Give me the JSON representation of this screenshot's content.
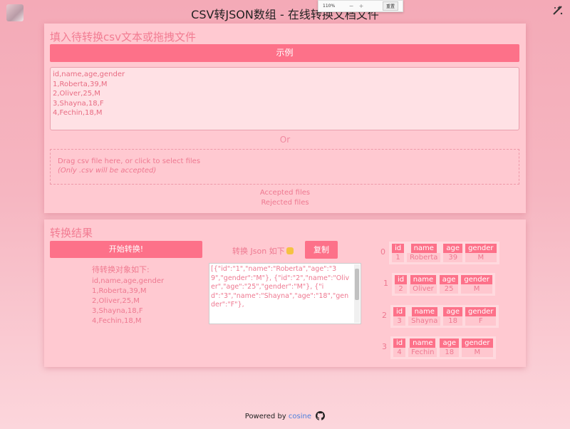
{
  "header": {
    "title": "CSV转JSON数组 - 在线转换文档文件"
  },
  "zoom_popup": {
    "value": "110%",
    "minus": "−",
    "plus": "+",
    "reset": "重置"
  },
  "input_card": {
    "title": "填入待转换csv文本或拖拽文件",
    "example_label": "示例",
    "csv_text": "id,name,age,gender\n1,Roberta,39,M\n2,Oliver,25,M\n3,Shayna,18,F\n4,Fechin,18,M",
    "or_label": "Or",
    "drop_hint": "Drag csv file here, or click to select files",
    "drop_note": "(Only .csv will be accepted)",
    "accepted_label": "Accepted files",
    "rejected_label": "Rejected files"
  },
  "result_card": {
    "title": "转换结果",
    "start_label": "开始转换!",
    "pending_title": "待转换对象如下:",
    "pending_lines": "id,name,age,gender\n1,Roberta,39,M\n2,Oliver,25,M\n3,Shayna,18,F\n4,Fechin,18,M",
    "json_label": "转换 Json 如下",
    "copy_label": "复制",
    "json_text": "[{\"id\":\"1\",\"name\":\"Roberta\",\"age\":\"39\",\"gender\":\"M\"},\n{\"id\":\"2\",\"name\":\"Oliver\",\"age\":\"25\",\"gender\":\"M\"},\n{\"id\":\"3\",\"name\":\"Shayna\",\"age\":\"18\",\"gender\":\"F\"},"
  },
  "objects": [
    {
      "index": "0",
      "id": "1",
      "name": "Roberta",
      "age": "39",
      "gender": "M"
    },
    {
      "index": "1",
      "id": "2",
      "name": "Oliver",
      "age": "25",
      "gender": "M"
    },
    {
      "index": "2",
      "id": "3",
      "name": "Shayna",
      "age": "18",
      "gender": "F"
    },
    {
      "index": "3",
      "id": "4",
      "name": "Fechin",
      "age": "18",
      "gender": "M"
    }
  ],
  "field_keys": {
    "id": "id",
    "name": "name",
    "age": "age",
    "gender": "gender"
  },
  "footer": {
    "powered_by": "Powered by",
    "author": "cosine"
  },
  "colors": {
    "accent": "#fd7189",
    "card": "#ffc9d1",
    "text": "#ee7890"
  }
}
